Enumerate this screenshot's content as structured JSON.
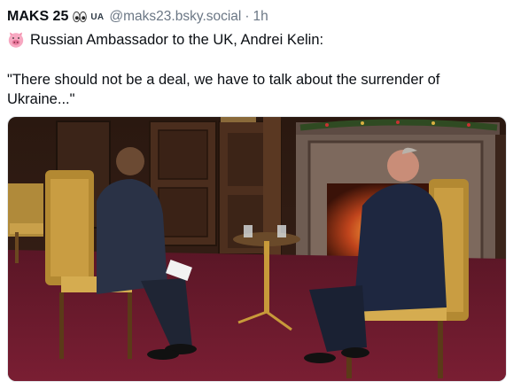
{
  "post": {
    "display_name": "MAKS 25",
    "eyes_icon": "eyes-emoji",
    "flag_label": "UA",
    "handle": "@maks23.bsky.social",
    "separator": "·",
    "timestamp": "1h",
    "emoji_icon": "pig-face-emoji",
    "text_line": "Russian Ambassador to the UK, Andrei Kelin:",
    "quote": "\"There should not be a deal, we have to talk about the surrender of Ukraine...\""
  },
  "colors": {
    "text": "#0b0f14",
    "muted": "#6b7785"
  }
}
